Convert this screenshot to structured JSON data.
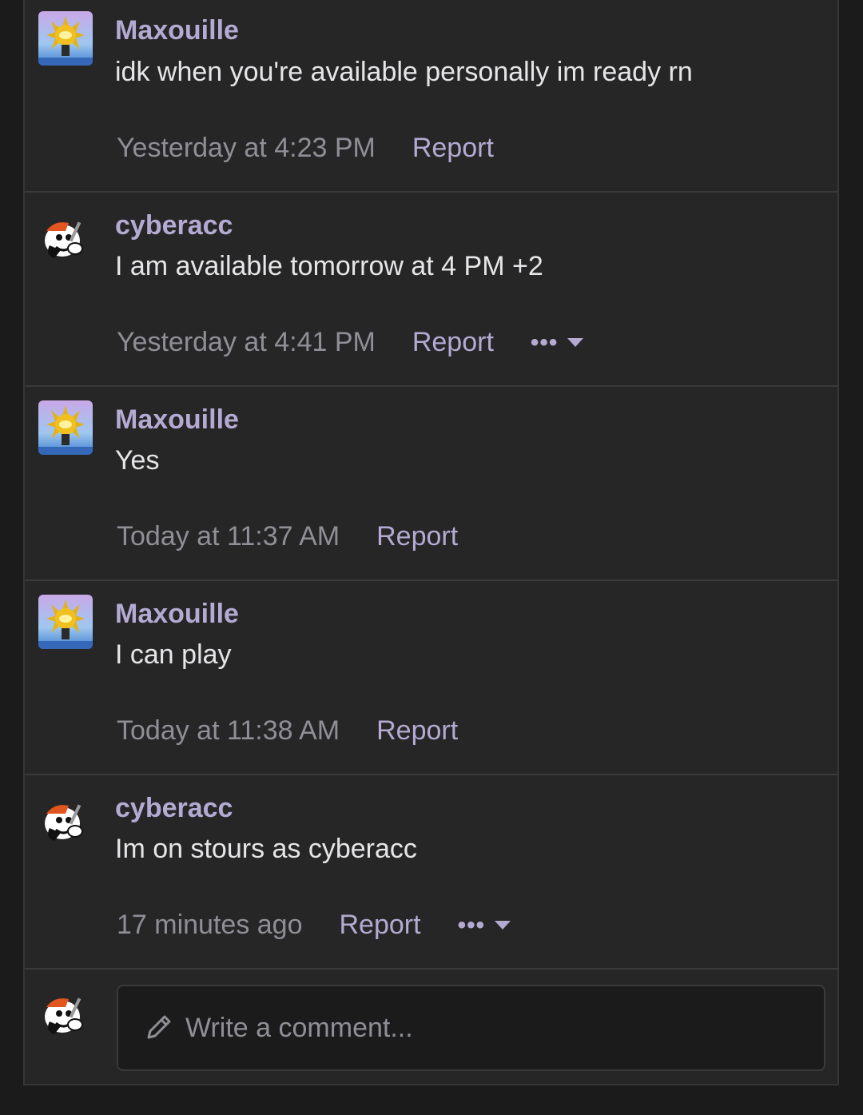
{
  "comments": [
    {
      "username": "Maxouille",
      "avatar": "sun-avatar",
      "text": "idk when you're available personally im ready rn",
      "time": "Yesterday at 4:23 PM",
      "report": "Report",
      "has_more": false
    },
    {
      "username": "cyberacc",
      "avatar": "cartoon-avatar",
      "text": "I am available tomorrow at 4 PM +2",
      "time": "Yesterday at 4:41 PM",
      "report": "Report",
      "has_more": true,
      "more": "•••"
    },
    {
      "username": "Maxouille",
      "avatar": "sun-avatar",
      "text": "Yes",
      "time": "Today at 11:37 AM",
      "report": "Report",
      "has_more": false
    },
    {
      "username": "Maxouille",
      "avatar": "sun-avatar",
      "text": "I can play",
      "time": "Today at 11:38 AM",
      "report": "Report",
      "has_more": false
    },
    {
      "username": "cyberacc",
      "avatar": "cartoon-avatar",
      "text": "Im on stours as cyberacc",
      "time": "17 minutes ago",
      "report": "Report",
      "has_more": true,
      "more": "•••"
    }
  ],
  "composer": {
    "placeholder": "Write a comment...",
    "icon": "pencil-icon"
  },
  "colors": {
    "background": "#1b1b1c",
    "panel": "#262627",
    "accent": "#b4aad2",
    "text": "#e6e6e8",
    "muted": "#8f8f96"
  }
}
